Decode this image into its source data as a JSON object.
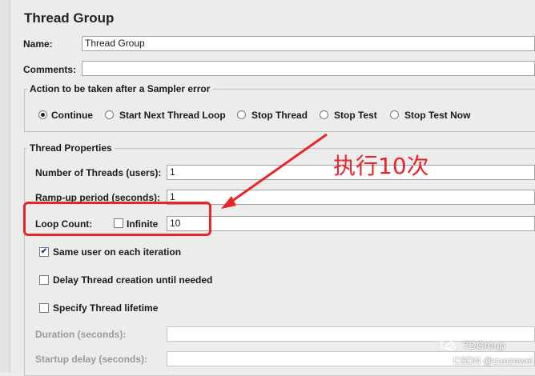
{
  "panel": {
    "title": "Thread Group"
  },
  "name": {
    "label": "Name:",
    "value": "Thread Group"
  },
  "comments": {
    "label": "Comments:",
    "value": ""
  },
  "sampler_error": {
    "legend": "Action to be taken after a Sampler error",
    "options": [
      "Continue",
      "Start Next Thread Loop",
      "Stop Thread",
      "Stop Test",
      "Stop Test Now"
    ],
    "selected": "Continue"
  },
  "thread_properties": {
    "legend": "Thread Properties",
    "threads_label": "Number of Threads (users):",
    "threads_value": "1",
    "rampup_label": "Ramp-up period (seconds):",
    "rampup_value": "1",
    "loop_label": "Loop Count:",
    "infinite_label": "Infinite",
    "infinite_checked": false,
    "loop_value": "10",
    "same_user_label": "Same user on each iteration",
    "same_user_checked": true,
    "delay_label": "Delay Thread creation until needed",
    "delay_checked": false,
    "lifetime_label": "Specify Thread lifetime",
    "lifetime_checked": false,
    "duration_label": "Duration (seconds):",
    "duration_value": "",
    "startup_label": "Startup delay (seconds):",
    "startup_value": ""
  },
  "annotation": {
    "text": "执行10次",
    "color": "#e8252a"
  },
  "watermark": {
    "brand": "7DGroup",
    "credit": "CSDN @zuozewei"
  },
  "colors": {
    "accent": "#e8252a",
    "background": "#ececec"
  }
}
